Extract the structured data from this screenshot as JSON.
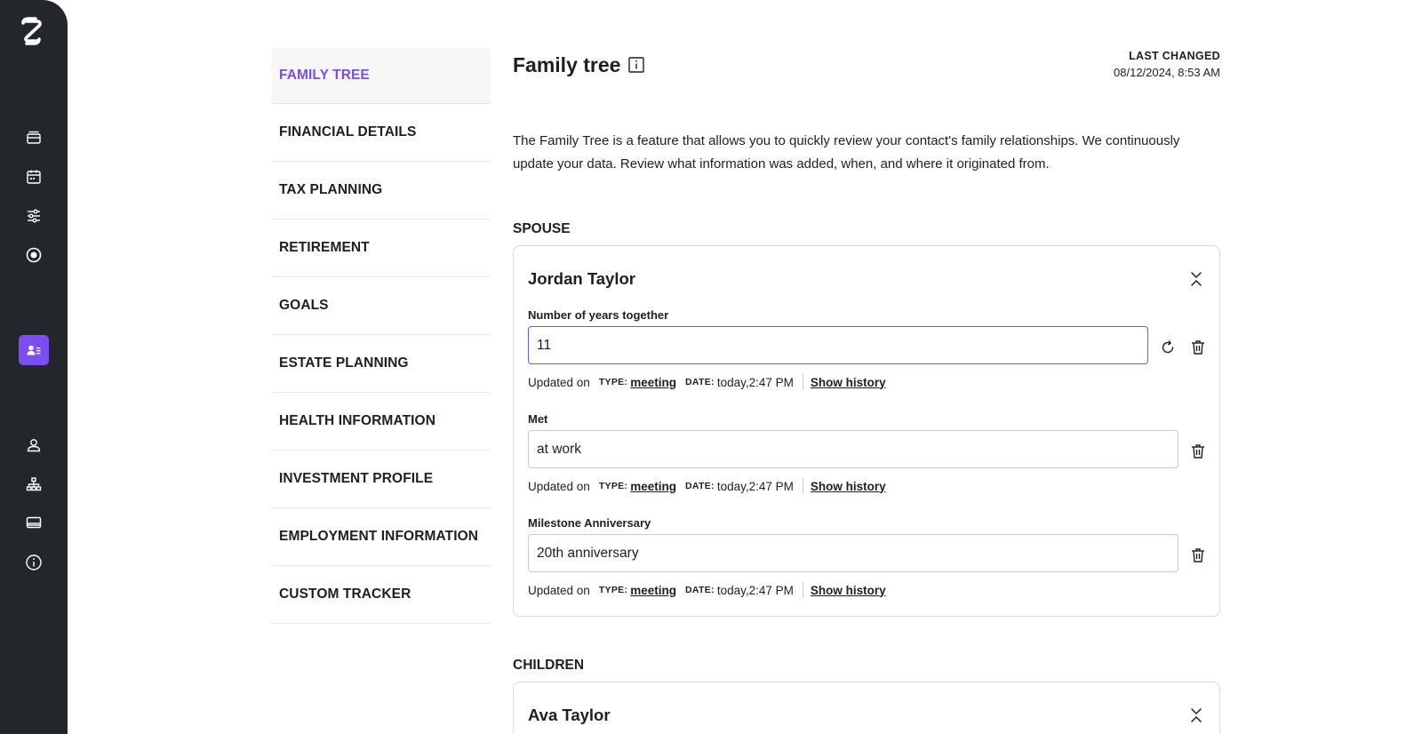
{
  "rail": {
    "logo": "app-logo",
    "icons": [
      "inbox-icon",
      "calendar-icon",
      "sliders-icon",
      "record-icon",
      "contact-card-icon",
      "user-icon",
      "hierarchy-icon",
      "card-icon",
      "info-icon"
    ],
    "active": "contact-card-icon",
    "accent": "#7a4ef0",
    "background": "#23262b"
  },
  "sections": [
    {
      "label": "FAMILY TREE",
      "active": true
    },
    {
      "label": "FINANCIAL DETAILS"
    },
    {
      "label": "TAX PLANNING"
    },
    {
      "label": "RETIREMENT"
    },
    {
      "label": "GOALS"
    },
    {
      "label": "ESTATE PLANNING"
    },
    {
      "label": "HEALTH INFORMATION"
    },
    {
      "label": "INVESTMENT PROFILE"
    },
    {
      "label": "EMPLOYMENT INFORMATION"
    },
    {
      "label": "CUSTOM TRACKER"
    }
  ],
  "header": {
    "title": "Family tree",
    "last_changed_label": "LAST CHANGED",
    "last_changed_value": "08/12/2024, 8:53 AM"
  },
  "description": "The Family Tree is a feature that allows you to quickly review your contact's family relationships. We continuously update your data. Review what information was added, when, and where it originated from.",
  "spouse": {
    "section_label": "SPOUSE",
    "name": "Jordan Taylor",
    "fields": [
      {
        "label": "Number of years together",
        "value": "11",
        "meta": {
          "updated": "Updated on",
          "type_label": "TYPE:",
          "type_value": "meeting",
          "date_label": "DATE:",
          "date_value": "today,2:47 PM",
          "history": "Show history"
        }
      },
      {
        "label": "Met",
        "value": "at work",
        "meta": {
          "updated": "Updated on",
          "type_label": "TYPE:",
          "type_value": "meeting",
          "date_label": "DATE:",
          "date_value": "today,2:47 PM",
          "history": "Show history"
        }
      },
      {
        "label": "Milestone Anniversary",
        "value": "20th anniversary",
        "meta": {
          "updated": "Updated on",
          "type_label": "TYPE:",
          "type_value": "meeting",
          "date_label": "DATE:",
          "date_value": "today,2:47 PM",
          "history": "Show history"
        }
      }
    ]
  },
  "children": {
    "section_label": "CHILDREN",
    "name": "Ava Taylor"
  }
}
